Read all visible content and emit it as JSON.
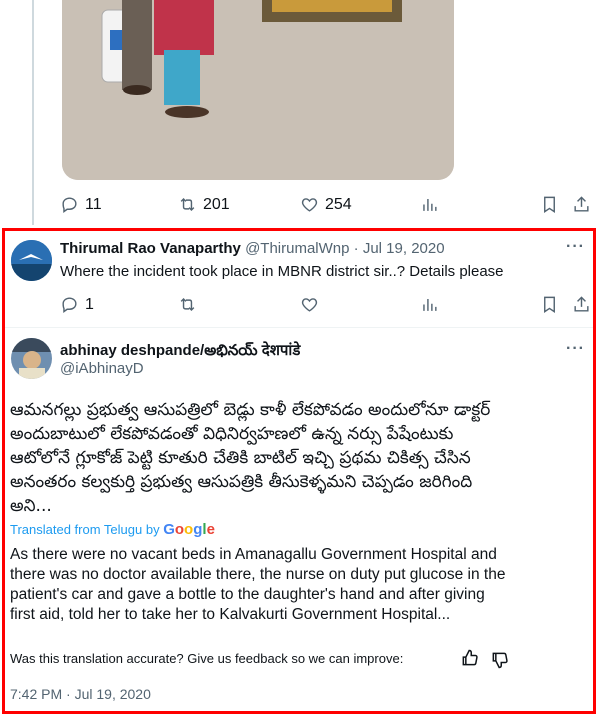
{
  "top_tweet": {
    "reply_count": "11",
    "retweet_count": "201",
    "like_count": "254"
  },
  "reply1": {
    "name": "Thirumal Rao Vanaparthy",
    "handle": "@ThirumalWnp",
    "separator": "·",
    "date": "Jul 19, 2020",
    "text": "Where the incident took place in MBNR district sir..? Details please",
    "reply_count": "1",
    "more": "···"
  },
  "reply2": {
    "name": "abhinay deshpande/అభినయ్ देशपांडे",
    "handle": "@iAbhinayD",
    "more": "···",
    "original_lines": [
      "ఆమనగల్లు ప్రభుత్వ ఆసుపత్రిలో బెడ్లు కాళీ లేకపోవడం అందులోనూ డాక్టర్",
      "అందుబాటులో లేకపోవడంతో విధినిర్వహణలో ఉన్న నర్సు పేషేంటుకు",
      "ఆటోలోనే గ్లూకోజ్  పెట్టి కూతురి చేతికి బాటిల్ ఇచ్చి ప్రథమ చికిత్స చేసిన",
      "అనంతరం కల్వకుర్తి ప్రభుత్వ ఆసుపత్రికి తీసుకెళ్ళమని చెప్పడం జరిగింది",
      "అని..."
    ],
    "translated_from": "Translated from Telugu by",
    "google_logo": "Google",
    "translation_lines": [
      "As there were no vacant beds in Amanagallu Government Hospital and",
      "there was no doctor available there, the nurse on duty put glucose in the",
      "patient's car and gave a bottle to the daughter's hand and after giving",
      "first aid, told her to take her to Kalvakurti Government Hospital..."
    ],
    "feedback": "Was this translation accurate? Give us feedback so we can improve:",
    "timestamp": "7:42 PM · Jul 19, 2020"
  },
  "colors": {
    "highlight_border": "#ff0000",
    "link_blue": "#1d9bf0",
    "muted": "#536471"
  }
}
